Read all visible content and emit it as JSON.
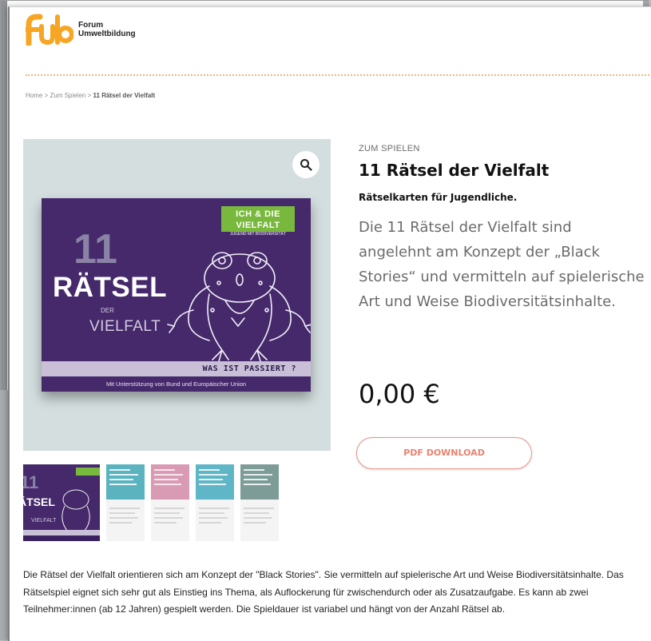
{
  "header": {
    "logo_mark": "fub",
    "logo_line1": "Forum",
    "logo_line2": "Umweltbildung"
  },
  "breadcrumb": {
    "home": "Home",
    "sep1": " > ",
    "section": "Zum Spielen",
    "sep2": " > ",
    "current": "11 Rätsel der Vielfalt"
  },
  "product": {
    "category": "ZUM SPIELEN",
    "title": "11 Rätsel der Vielfalt",
    "subtitle": "Rätselkarten für Jugendliche.",
    "description": "Die 11 Rätsel der Vielfalt sind angelehnt am Konzept der „Black Stories“ und vermitteln auf spielerische Art und Weise Biodiversitätsinhalte.",
    "price": "0,00 €",
    "download_label": "PDF DOWNLOAD"
  },
  "cover": {
    "badge_title": "ICH & DIE VIELFALT",
    "badge_sub": "JUGEND MIT BIODIVERSITÄT",
    "number": "11",
    "word1": "RÄTSEL",
    "word2": "DER",
    "word3": "VIELFALT",
    "strip": "WAS IST PASSIERT ?",
    "footer": "Mit Unterstützung von Bund und Europäischer Union"
  },
  "long_description": "Die Rätsel der Vielfalt orientieren sich am Konzept der \"Black Stories\". Sie vermitteln auf spielerische Art und Weise Biodiversitätsinhalte. Das Rätselspiel eignet sich sehr gut als Einstieg ins Thema, als Auflockerung für zwischendurch oder als Zusatzaufgabe. Es kann ab zwei Teilnehmer:innen (ab 12 Jahren) gespielt werden. Die Spieldauer ist variabel und hängt von der Anzahl Rätsel ab.",
  "icons": {
    "zoom": "magnifier-icon"
  },
  "colors": {
    "accent_orange": "#f6a623",
    "button_red": "#e9826f",
    "cover_purple": "#45296b",
    "badge_green": "#77b83d"
  }
}
